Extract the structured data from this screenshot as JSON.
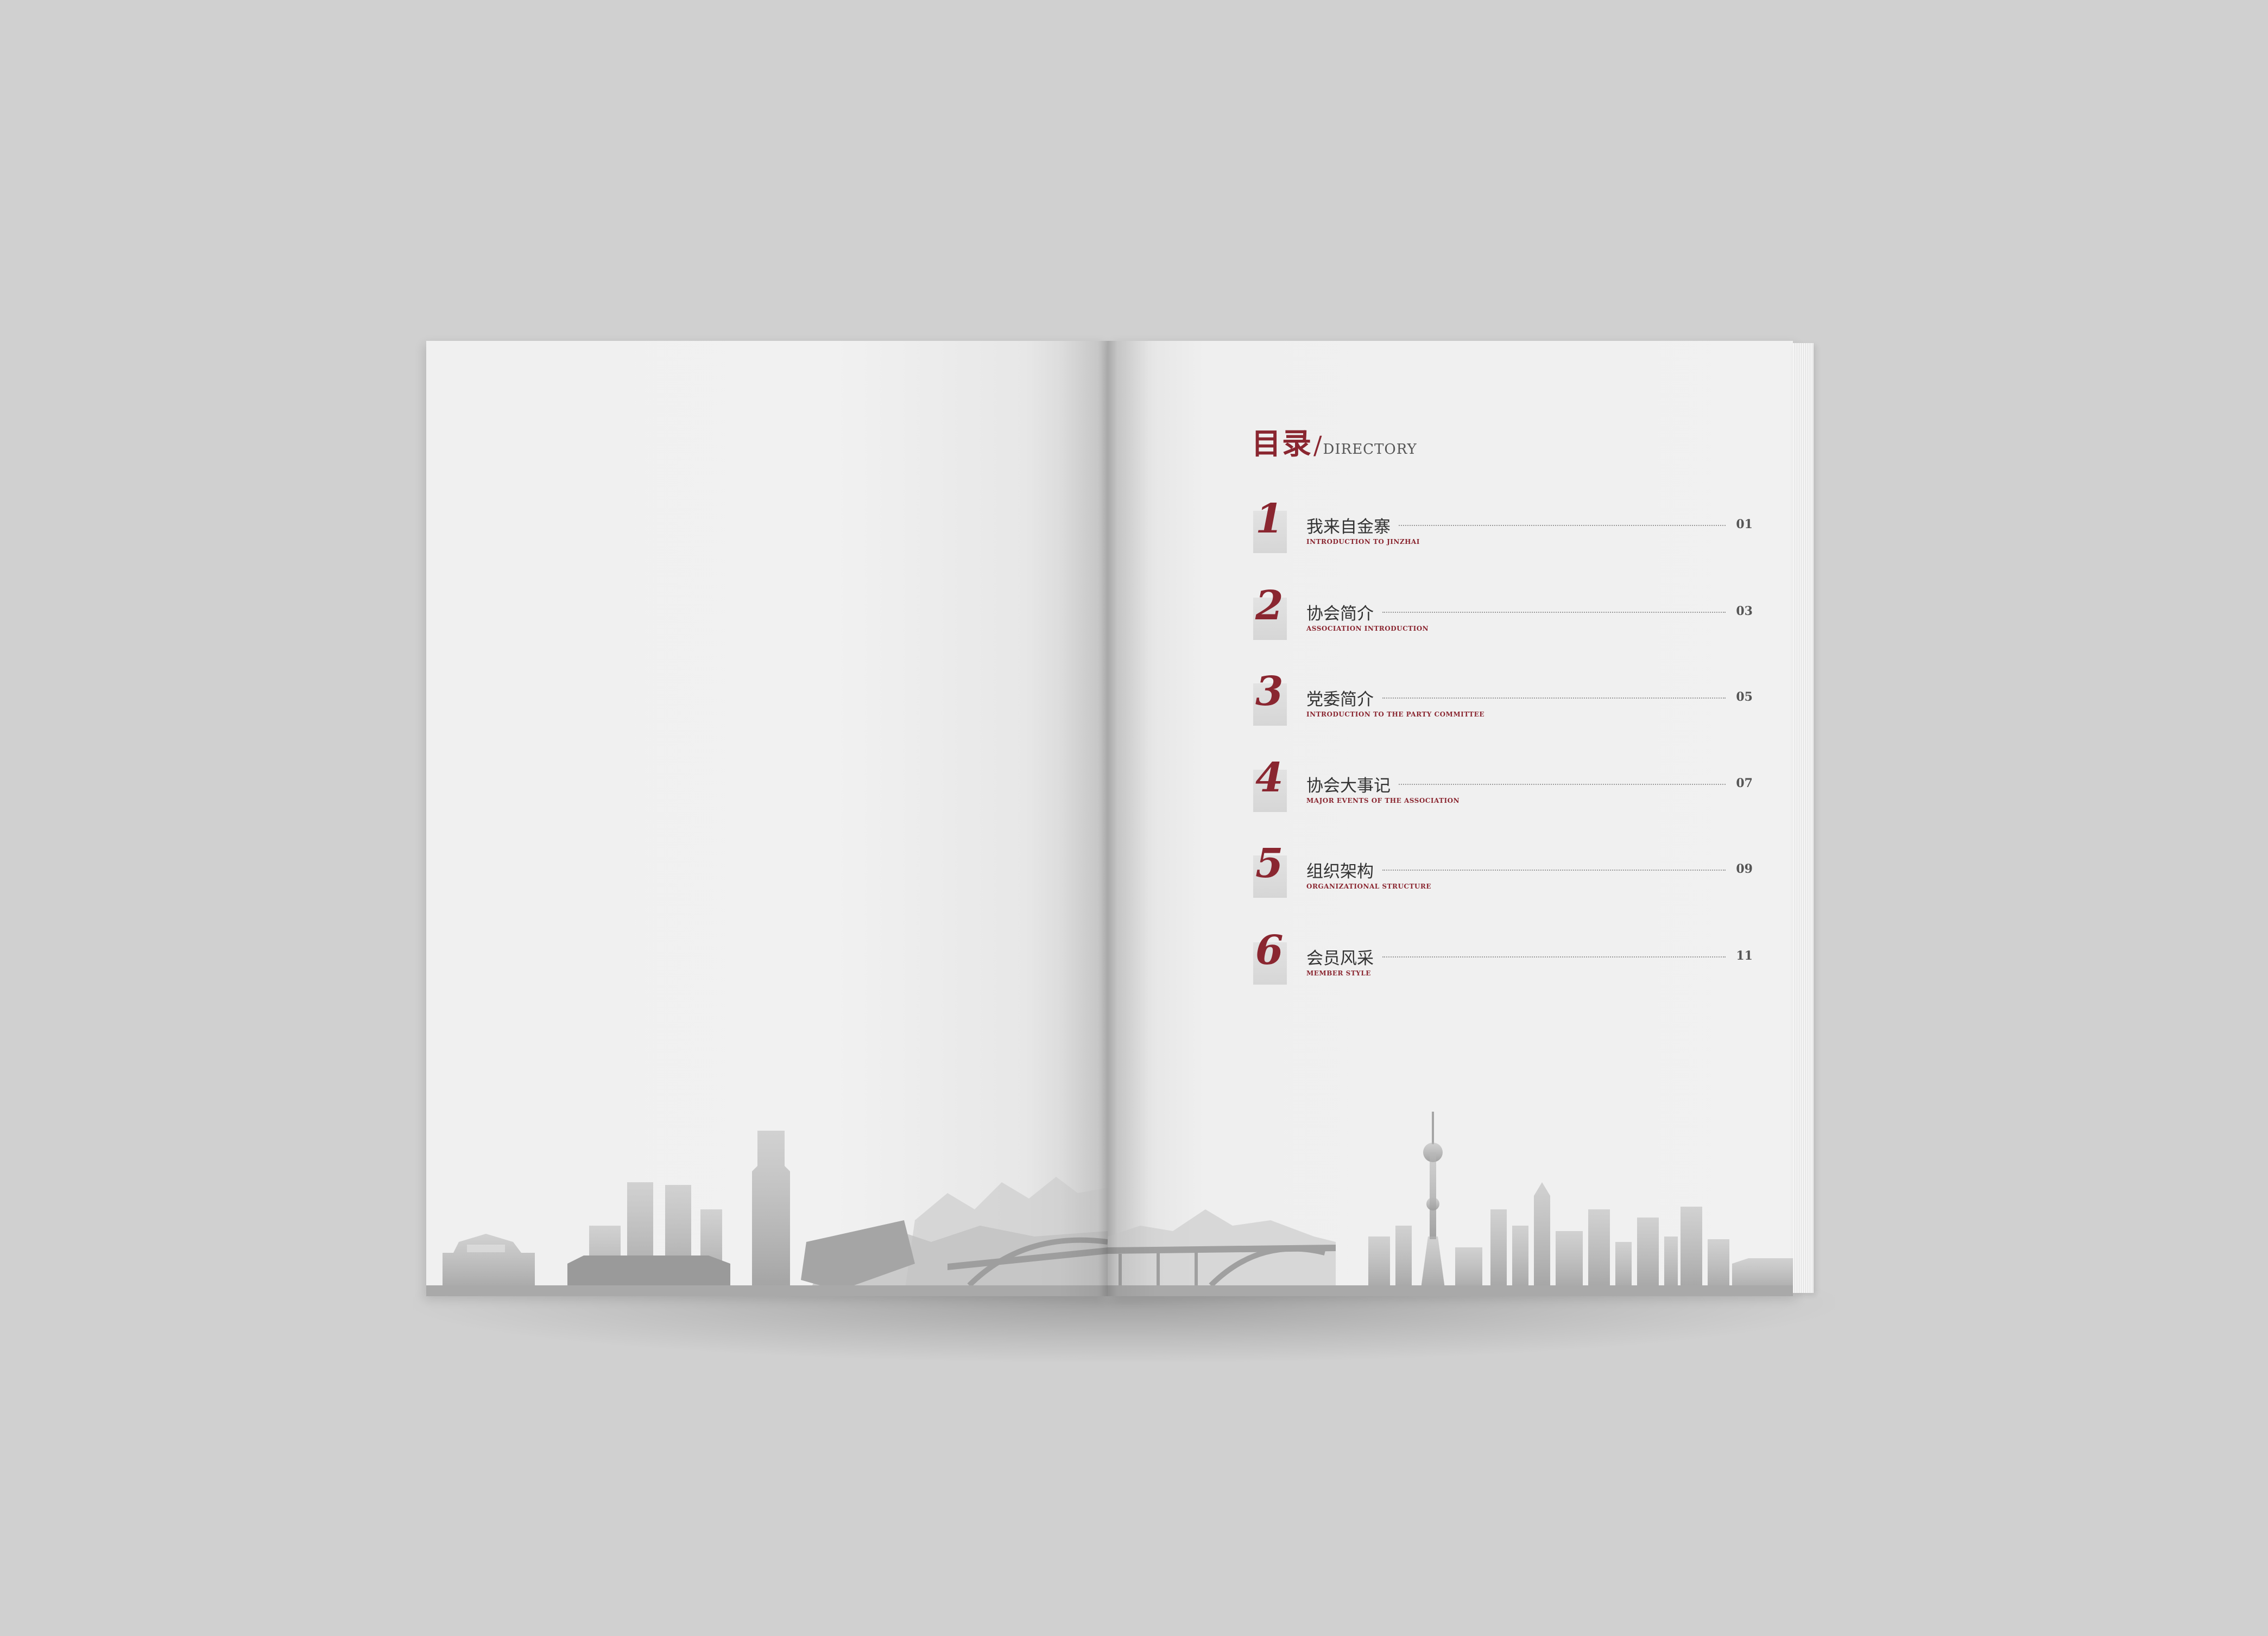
{
  "toc": {
    "title": "目录",
    "slash": "/",
    "subtitle": "DIRECTORY",
    "items": [
      {
        "num": "1",
        "title": "我来自金寨",
        "subtitle": "INTRODUCTION TO JINZHAI",
        "page": "01"
      },
      {
        "num": "2",
        "title": "协会简介",
        "subtitle": "ASSOCIATION INTRODUCTION",
        "page": "03"
      },
      {
        "num": "3",
        "title": "党委简介",
        "subtitle": "INTRODUCTION TO THE PARTY COMMITTEE",
        "page": "05"
      },
      {
        "num": "4",
        "title": "协会大事记",
        "subtitle": "MAJOR EVENTS OF THE ASSOCIATION",
        "page": "07"
      },
      {
        "num": "5",
        "title": "组织架构",
        "subtitle": "ORGANIZATIONAL STRUCTURE",
        "page": "09"
      },
      {
        "num": "6",
        "title": "会员风采",
        "subtitle": "MEMBER STYLE",
        "page": "11"
      }
    ]
  },
  "colors": {
    "accent": "#8a2630",
    "background": "#d0d0d0",
    "paper": "#f1f1f1",
    "skyline": "#a9a9a9"
  }
}
